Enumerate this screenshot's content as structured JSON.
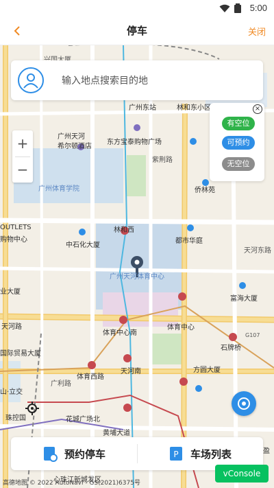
{
  "status": {
    "time": "5:00"
  },
  "nav": {
    "title": "停车",
    "close_label": "关闭"
  },
  "search": {
    "placeholder": "输入地点搜索目的地"
  },
  "zoom": {
    "plus": "+",
    "minus": "−"
  },
  "legend": {
    "items": [
      {
        "label": "有空位",
        "color": "#2fb34a"
      },
      {
        "label": "可预约",
        "color": "#2e8ee6"
      },
      {
        "label": "无空位",
        "color": "#8c8c8c"
      }
    ]
  },
  "bottom": {
    "reserve_label": "预约停车",
    "list_label": "车场列表"
  },
  "map": {
    "labels": [
      "兴国大厦",
      "广州东站",
      "林和东小区",
      "广州天河",
      "希尔顿酒店",
      "东方宝泰购物广场",
      "紫荆路",
      "侨林苑",
      "广州体育学院",
      "OUTLETS",
      "购物中心",
      "林和西",
      "中石化大厦",
      "都市华庭",
      "天河东路",
      "广州天河体育中心",
      "富海大厦",
      "业大厦",
      "天河路",
      "体育中心",
      "体育中心南",
      "G107",
      "石牌桥",
      "国际贸易大厦",
      "体育西路",
      "天河南",
      "方圆大厦",
      "广利路",
      "山·立交",
      "珠控国",
      "花城广场北",
      "黄埔大道",
      "心珠江新城发区",
      "盈"
    ]
  },
  "footer": {
    "copyright": "高德地图 © 2022 AutoNavi - GS(2021)6375号",
    "vconsole_label": "vConsole"
  }
}
